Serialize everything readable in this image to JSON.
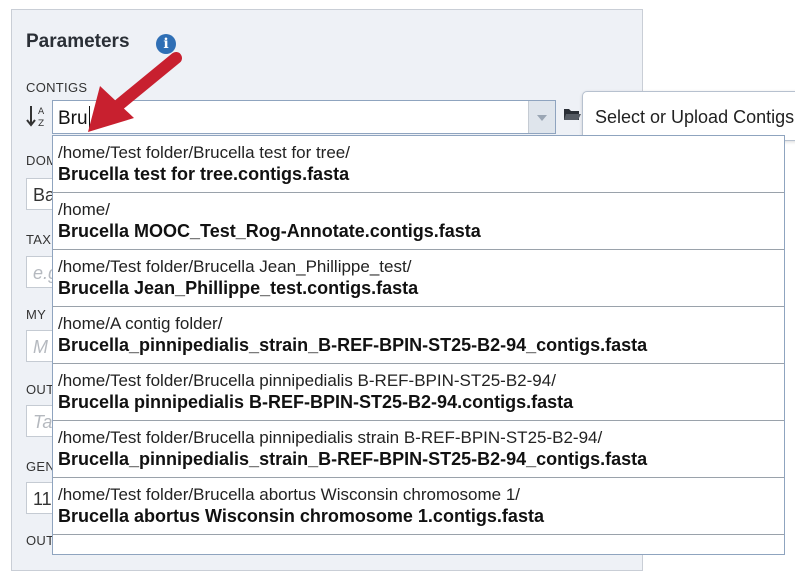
{
  "panel": {
    "title": "Parameters",
    "info_icon": "info-icon"
  },
  "fields": {
    "contigs_label": "CONTIGS",
    "domain_label": "DOM",
    "domain_value": "Ba",
    "taxonomy_label": "TAX",
    "taxonomy_placeholder": "e.g",
    "my_label": "MY",
    "my_placeholder": "M",
    "output_label": "OUT",
    "output_placeholder": "Ta",
    "genetic_label": "GEN",
    "genetic_value": "11",
    "bottom_label": "OUT"
  },
  "contigs_input": {
    "value": "Bru"
  },
  "tooltip": {
    "text": "Select or Upload Contigs"
  },
  "dropdown": {
    "items": [
      {
        "path": "/home/Test folder/Brucella test for tree/",
        "file": "Brucella test for tree.contigs.fasta"
      },
      {
        "path": "/home/",
        "file": "Brucella MOOC_Test_Rog-Annotate.contigs.fasta"
      },
      {
        "path": "/home/Test folder/Brucella Jean_Phillippe_test/",
        "file": "Brucella Jean_Phillippe_test.contigs.fasta"
      },
      {
        "path": "/home/A contig folder/",
        "file": "Brucella_pinnipedialis_strain_B-REF-BPIN-ST25-B2-94_contigs.fasta"
      },
      {
        "path": "/home/Test folder/Brucella pinnipedialis B-REF-BPIN-ST25-B2-94/",
        "file": "Brucella pinnipedialis B-REF-BPIN-ST25-B2-94.contigs.fasta"
      },
      {
        "path": "/home/Test folder/Brucella pinnipedialis strain B-REF-BPIN-ST25-B2-94/",
        "file": "Brucella_pinnipedialis_strain_B-REF-BPIN-ST25-B2-94_contigs.fasta"
      },
      {
        "path": "/home/Test folder/Brucella abortus Wisconsin chromosome 1/",
        "file": "Brucella abortus Wisconsin chromosome 1.contigs.fasta"
      }
    ]
  },
  "colors": {
    "panel_bg": "#eef1f6",
    "accent_blue": "#2f6fb5",
    "arrow_red": "#c8202f"
  }
}
